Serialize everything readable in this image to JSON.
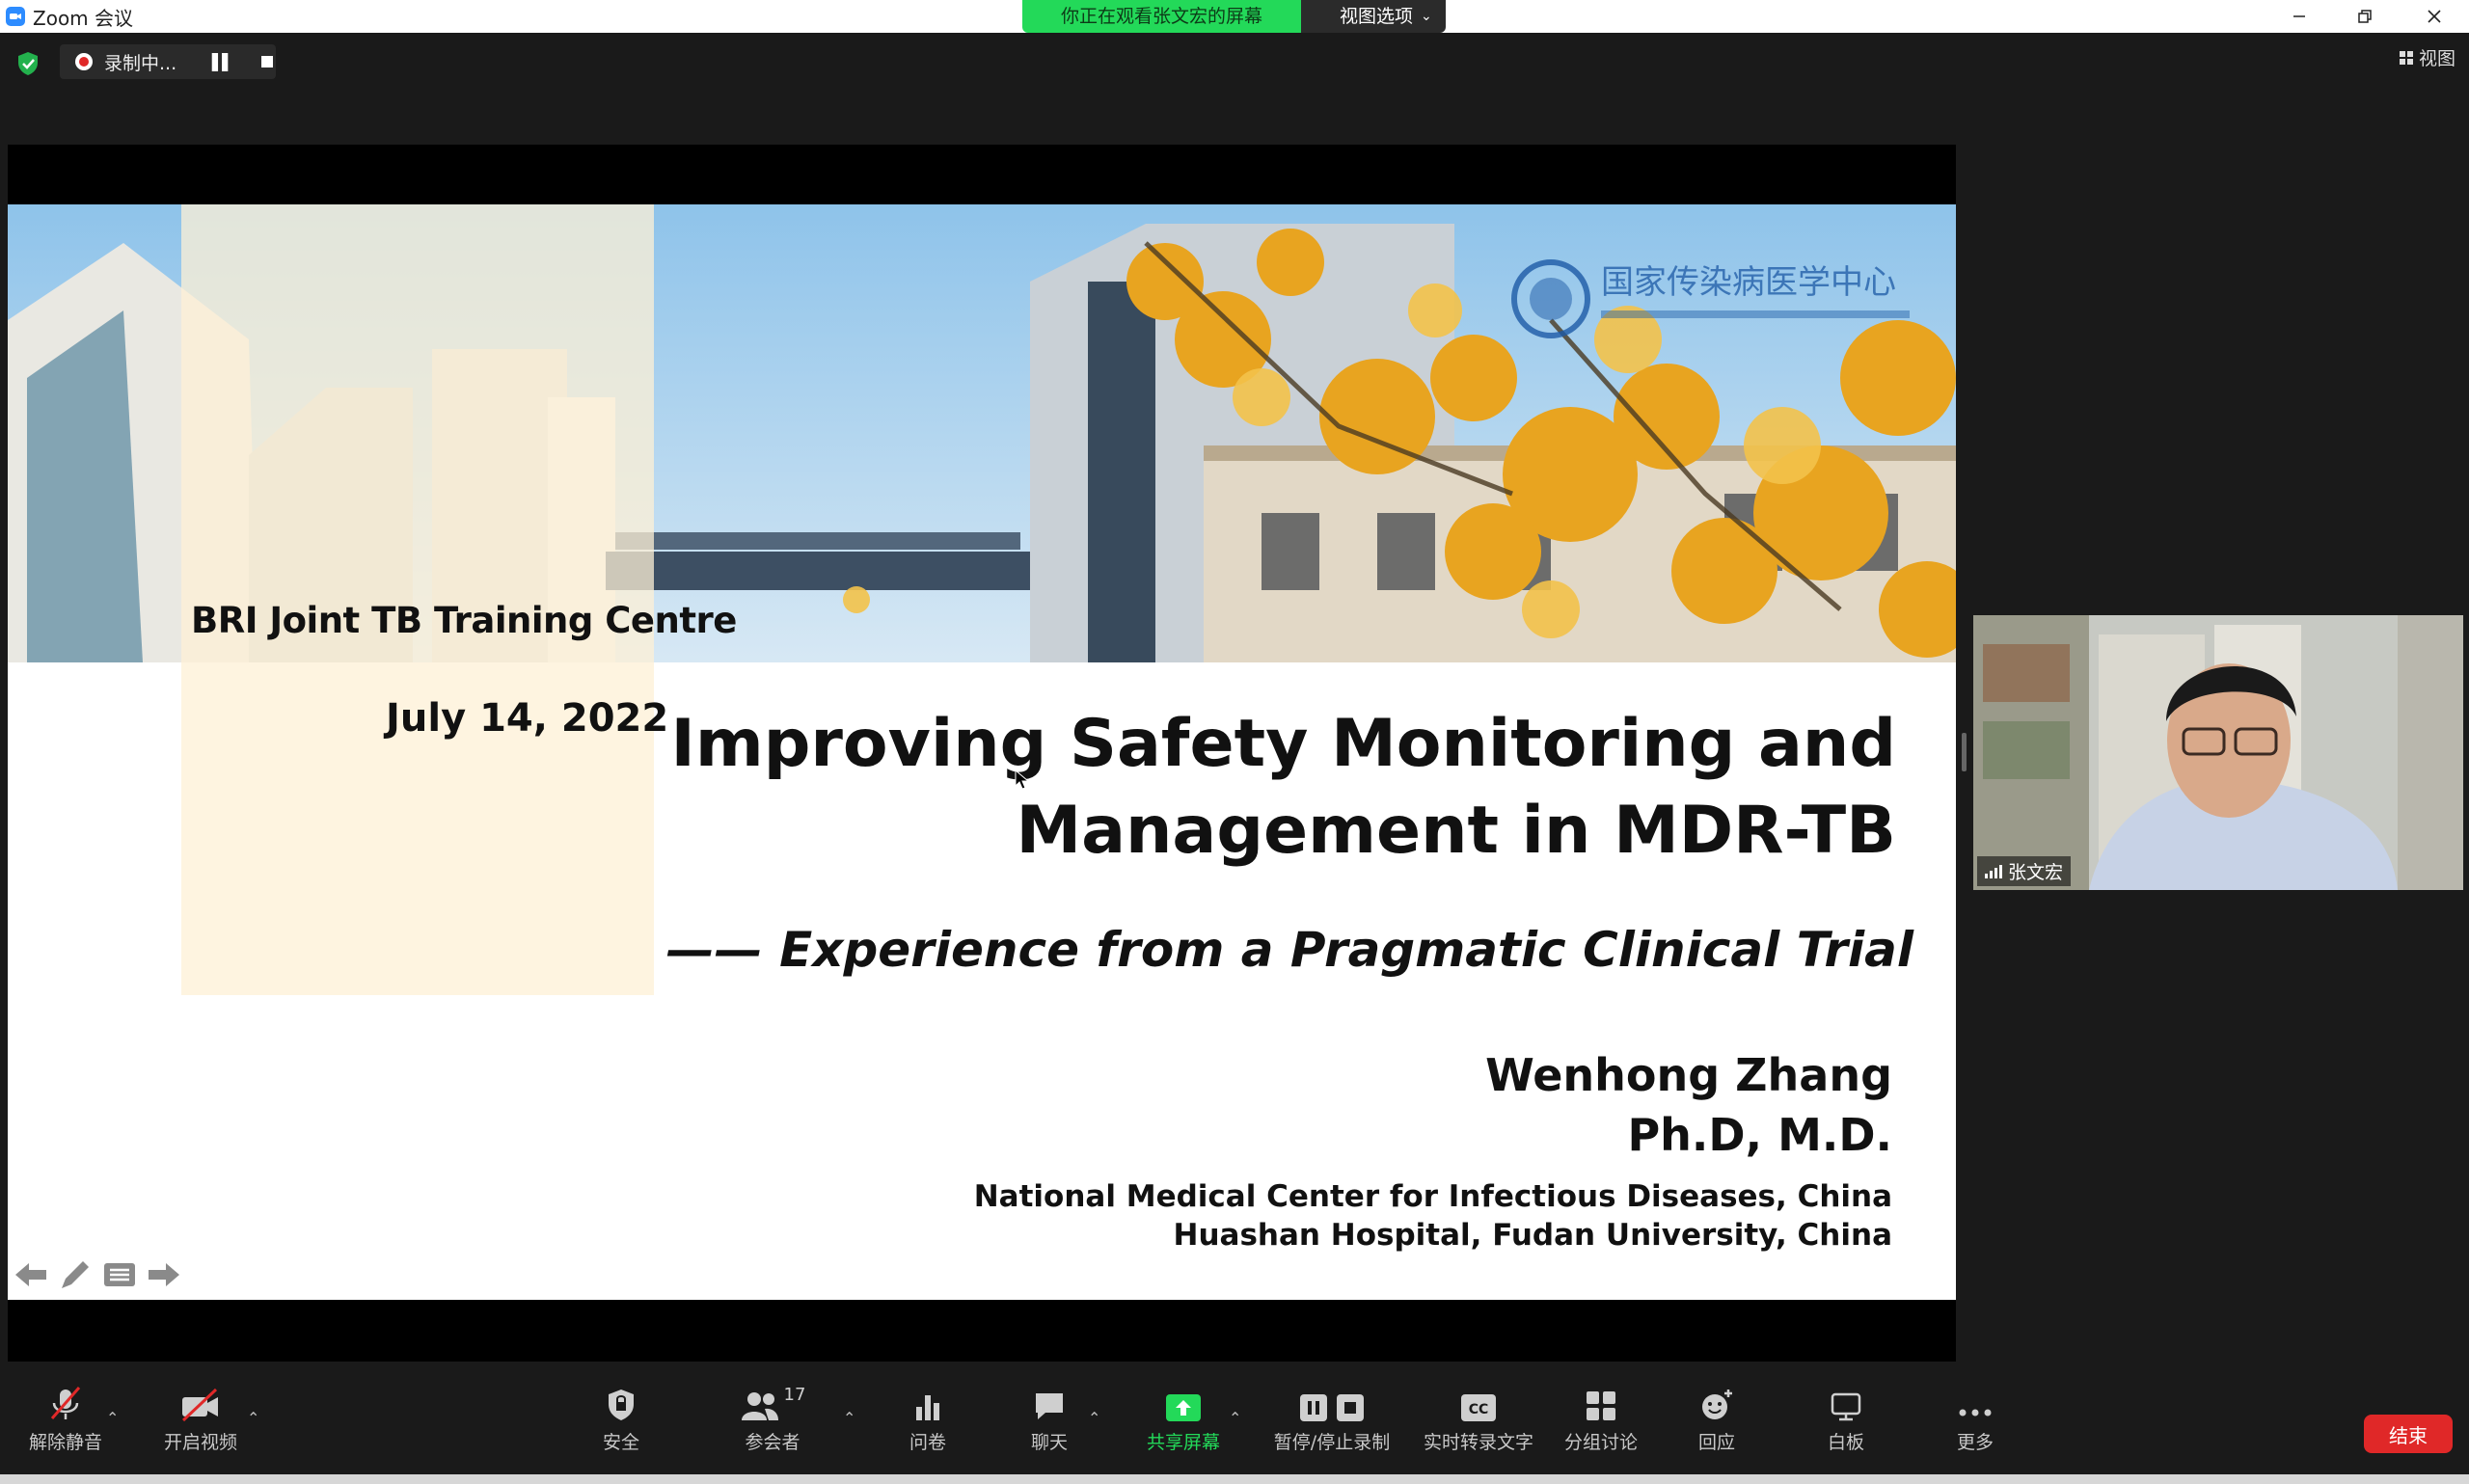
{
  "window": {
    "title": "Zoom 会议",
    "share_notice": "你正在观看张文宏的屏幕",
    "view_options": "视图选项"
  },
  "recording": {
    "label": "录制中..."
  },
  "view_button": "视图",
  "slide": {
    "center": "BRI Joint TB Training Centre",
    "date": "July 14, 2022",
    "title_line1": "Improving Safety Monitoring and",
    "title_line2": "Management in MDR-TB",
    "subtitle": "—— Experience from a Pragmatic Clinical Trial",
    "author": "Wenhong Zhang",
    "degree": "Ph.D, M.D.",
    "affiliation1": "National Medical Center for Infectious Diseases, China",
    "affiliation2": "Huashan Hospital, Fudan University, China",
    "logo_text": "国家传染病医学中心"
  },
  "participant": {
    "name": "张文宏"
  },
  "toolbar": {
    "unmute": "解除静音",
    "start_video": "开启视频",
    "security": "安全",
    "participants": "参会者",
    "participants_count": "17",
    "polls": "问卷",
    "chat": "聊天",
    "share_screen": "共享屏幕",
    "pause_stop_recording": "暂停/停止录制",
    "live_transcript": "实时转录文字",
    "breakout": "分组讨论",
    "reactions": "回应",
    "whiteboard": "白板",
    "more": "更多",
    "end": "结束"
  },
  "colors": {
    "accent_green": "#23d959",
    "end_red": "#e02828",
    "zoom_blue": "#2d8cff"
  }
}
